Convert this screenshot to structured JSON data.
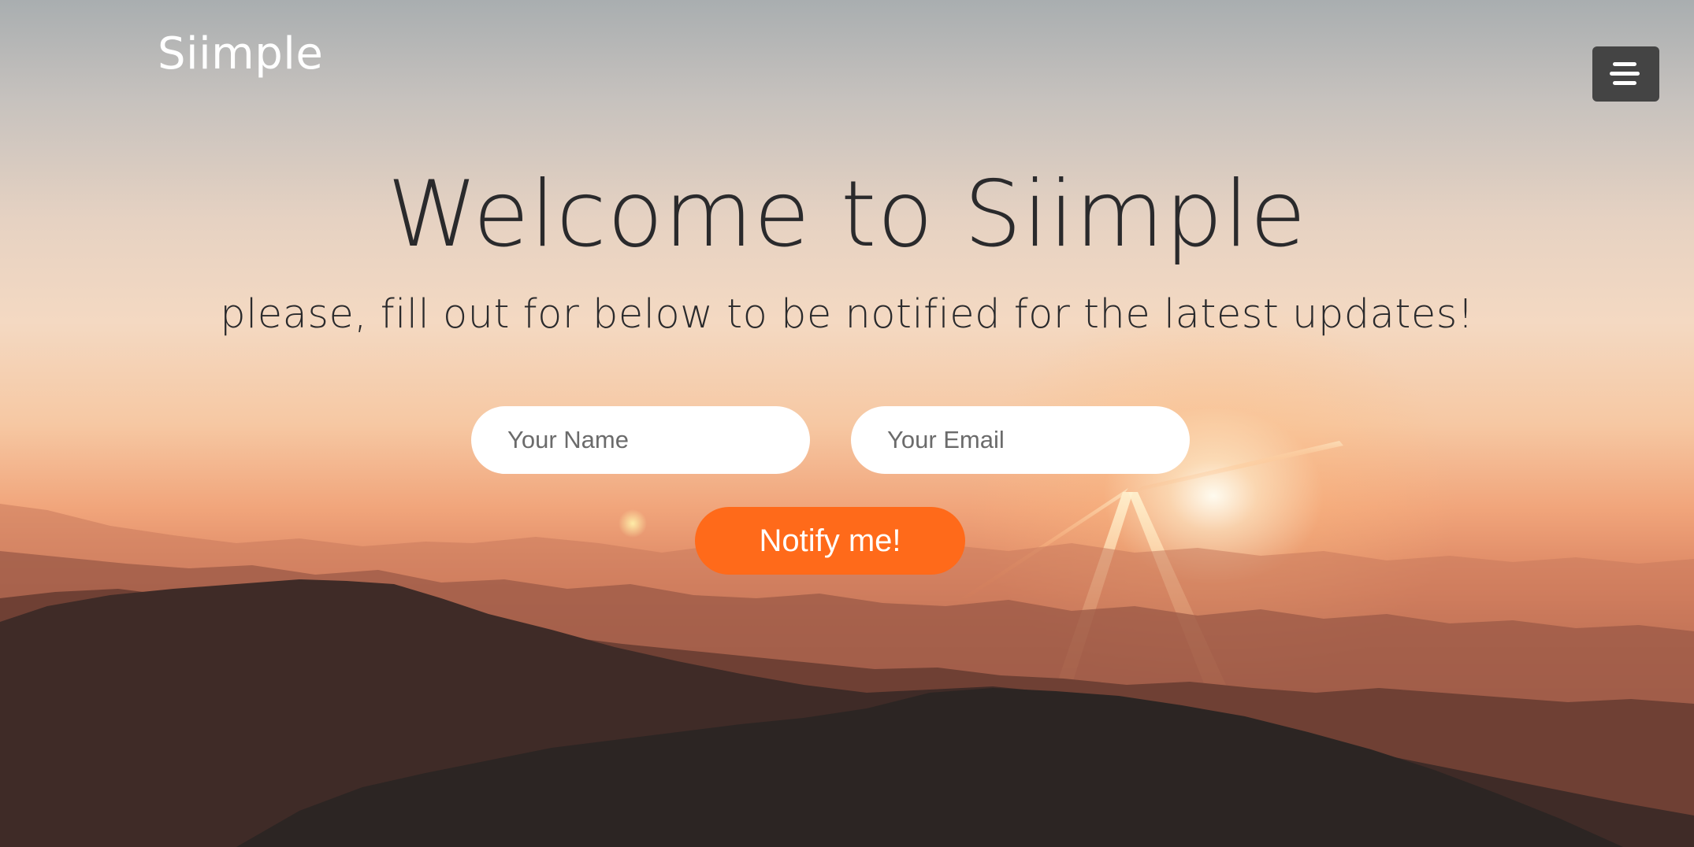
{
  "nav": {
    "brand": "Siimple",
    "menu_icon": "hamburger-menu-icon"
  },
  "hero": {
    "title": "Welcome to Siimple",
    "subtitle": "please, fill out for below to be notified for the latest updates!"
  },
  "form": {
    "name_placeholder": "Your Name",
    "email_placeholder": "Your Email",
    "submit_label": "Notify me!"
  },
  "colors": {
    "accent": "#ff6a1a",
    "menu_button": "#444444",
    "heading_text": "#2a2a2c"
  }
}
